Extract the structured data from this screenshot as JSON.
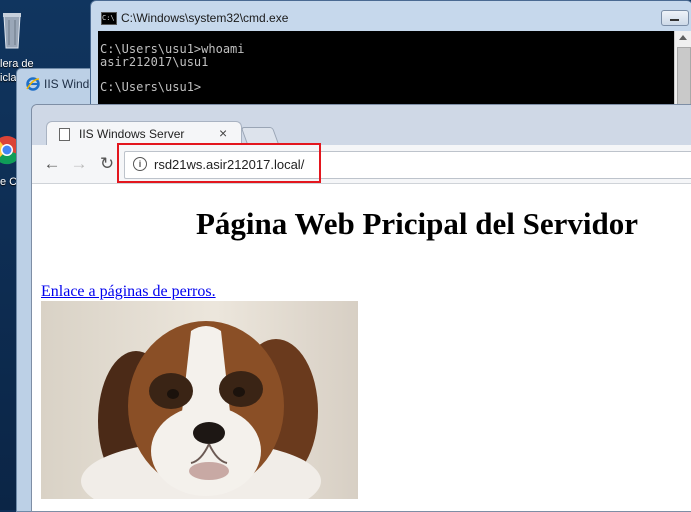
{
  "desktop": {
    "icons": [
      {
        "name": "recycle-bin",
        "label_lines": [
          "lera de",
          "icla"
        ]
      },
      {
        "name": "google-chrome",
        "label_lines": [
          "e Ch"
        ]
      }
    ]
  },
  "background_window": {
    "title": "IIS Windo"
  },
  "cmd": {
    "title": "C:\\Windows\\system32\\cmd.exe",
    "lines": [
      "C:\\Users\\usu1>whoami",
      "asir212017\\usu1",
      "",
      "C:\\Users\\usu1>"
    ]
  },
  "browser": {
    "tab_title": "IIS Windows Server",
    "tab_close": "×",
    "nav": {
      "back": "←",
      "forward": "→",
      "reload": "↻"
    },
    "info_icon": "i",
    "url": "rsd21ws.asir212017.local/",
    "highlight_color": "#e3161e"
  },
  "page": {
    "heading": "Página Web Pricipal del Servidor",
    "link_text": "Enlace a páginas de perros.",
    "image_subject": "saint-bernard-puppy"
  }
}
